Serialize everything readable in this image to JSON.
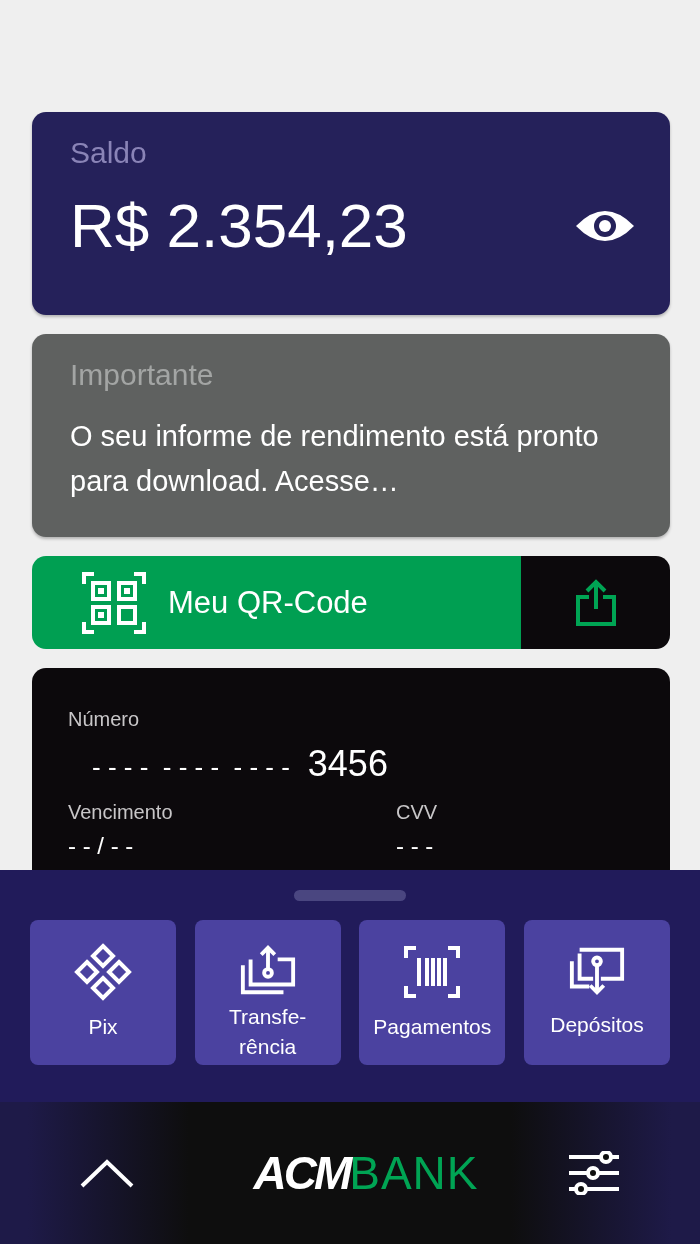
{
  "balance": {
    "label": "Saldo",
    "amount": "R$ 2.354,23"
  },
  "notice": {
    "title": "Importante",
    "text": "O seu informe de rendimento está pronto para download. Acesse…"
  },
  "qr_button": {
    "label": "Meu QR-Code"
  },
  "card": {
    "number_label": "Número",
    "number_mask": "- - - -  - - - -  - - - -",
    "number_last": "3456",
    "expiry_label": "Vencimento",
    "expiry_value": "- - / - -",
    "cvv_label": "CVV",
    "cvv_value": "- - -"
  },
  "actions": [
    {
      "kind": "pix",
      "label": "Pix"
    },
    {
      "kind": "transfer",
      "label": "Transfe-\nrência"
    },
    {
      "kind": "payments",
      "label": "Pagamentos"
    },
    {
      "kind": "deposits",
      "label": "Depósitos"
    }
  ],
  "bottom_bar": {
    "logo_primary": "ACM",
    "logo_secondary": "BANK"
  }
}
